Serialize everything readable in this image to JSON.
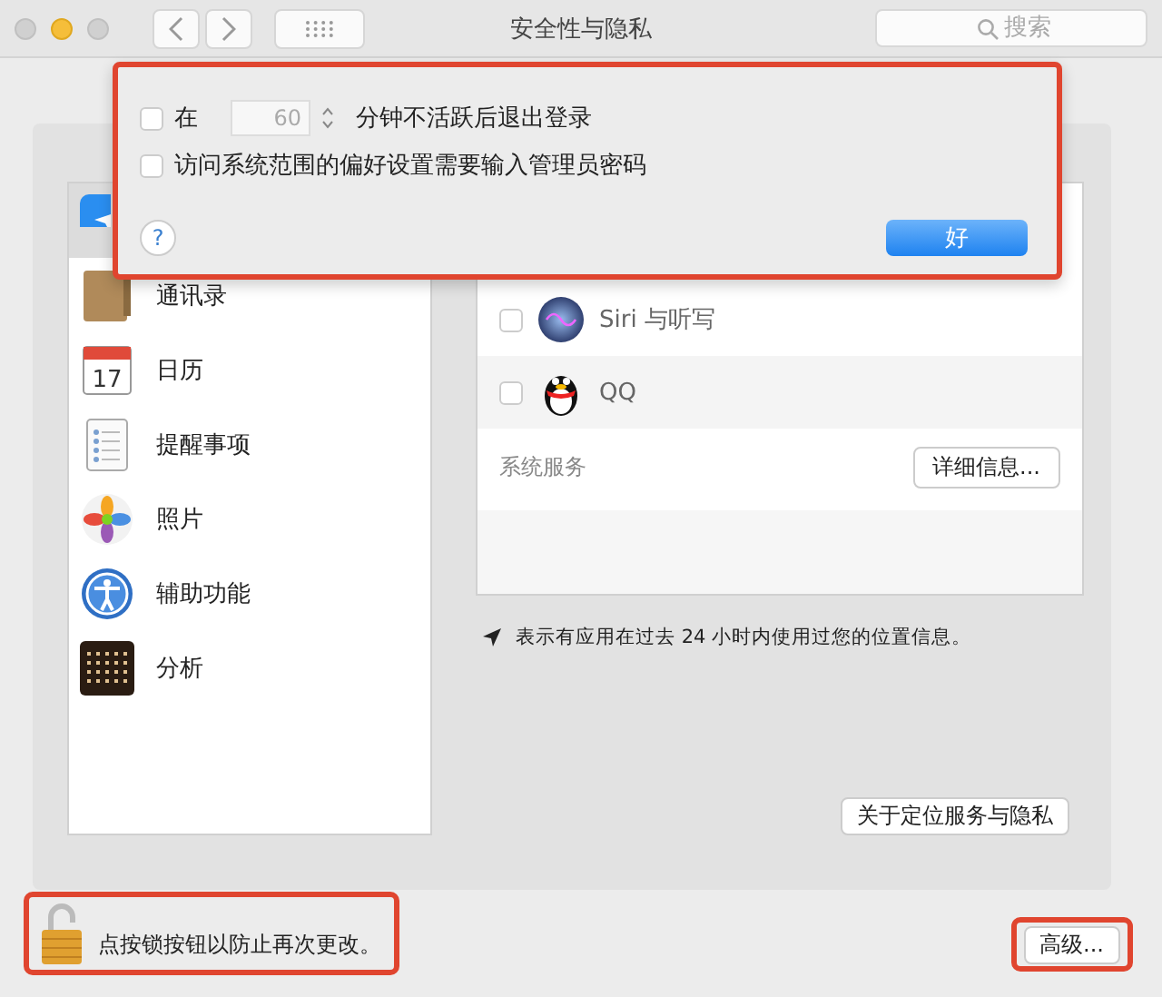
{
  "window": {
    "title": "安全性与隐私"
  },
  "toolbar": {
    "search_placeholder": "搜索"
  },
  "sheet": {
    "options": [
      {
        "kind": "timeout",
        "checked": false,
        "prefix": "在",
        "value": "60",
        "suffix": "分钟不活跃后退出登录"
      },
      {
        "kind": "plain",
        "checked": false,
        "label": "访问系统范围的偏好设置需要输入管理员密码"
      }
    ],
    "help": "?",
    "ok_button": "好"
  },
  "sidebar": {
    "items": [
      {
        "selected": true
      },
      {
        "label": "通讯录",
        "selected": false
      },
      {
        "label": "日历",
        "icon_text": "17",
        "selected": false
      },
      {
        "label": "提醒事项",
        "selected": false
      },
      {
        "label": "照片",
        "selected": false
      },
      {
        "label": "辅助功能",
        "selected": false
      },
      {
        "label": "分析",
        "selected": false
      }
    ]
  },
  "apps": [
    {
      "name": "Siri 与听写",
      "checked": false
    },
    {
      "name": "QQ",
      "checked": false
    }
  ],
  "system_services": {
    "label": "系统服务",
    "button": "详细信息..."
  },
  "note": "表示有应用在过去 24 小时内使用过您的位置信息。",
  "about_button": "关于定位服务与隐私",
  "lock_text": "点按锁按钮以防止再次更改。",
  "advanced_button": "高级..."
}
